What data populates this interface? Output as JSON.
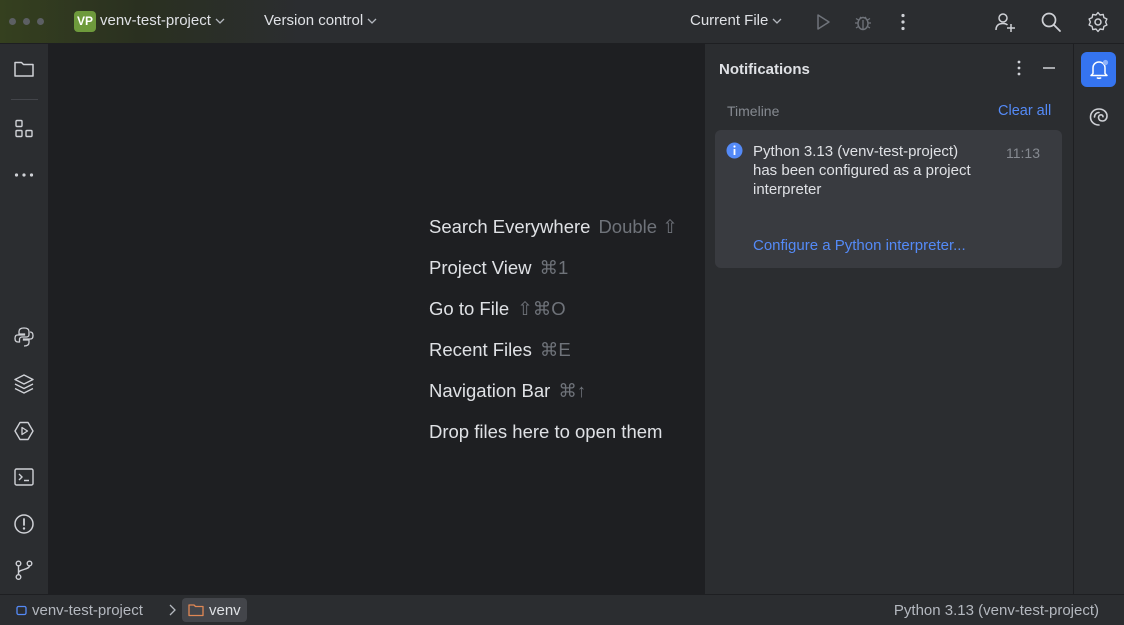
{
  "titlebar": {
    "project_badge": "VP",
    "project_name": "venv-test-project",
    "vcs_label": "Version control",
    "run_config": "Current File"
  },
  "editor": {
    "hints": [
      {
        "label": "Search Everywhere",
        "shortcut": "Double ⇧"
      },
      {
        "label": "Project View",
        "shortcut": "⌘1"
      },
      {
        "label": "Go to File",
        "shortcut": "⇧⌘O"
      },
      {
        "label": "Recent Files",
        "shortcut": "⌘E"
      },
      {
        "label": "Navigation Bar",
        "shortcut": "⌘↑"
      },
      {
        "label": "Drop files here to open them",
        "shortcut": ""
      }
    ]
  },
  "notifications": {
    "title": "Notifications",
    "timeline_label": "Timeline",
    "clear_all": "Clear all",
    "items": [
      {
        "message": "Python 3.13 (venv-test-project) has been configured as a project interpreter",
        "time": "11:13",
        "action": "Configure a Python interpreter..."
      }
    ]
  },
  "statusbar": {
    "breadcrumb_project": "venv-test-project",
    "breadcrumb_folder": "venv",
    "interpreter": "Python 3.13 (venv-test-project)"
  },
  "colors": {
    "accent": "#3574f0",
    "link": "#548af7",
    "project_badge": "#6e9a3c",
    "background": "#1e1f22",
    "panel": "#2b2d30"
  }
}
